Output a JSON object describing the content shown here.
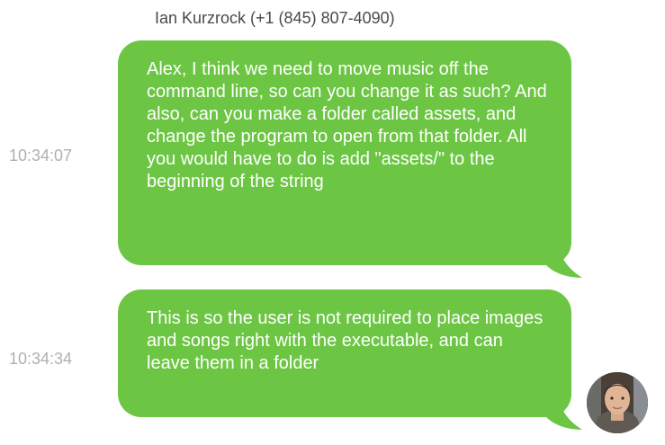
{
  "conversation": {
    "sender": "Ian Kurzrock (+1 (845) 807-4090)",
    "messages": [
      {
        "time": "10:34:07",
        "text": "Alex, I think we need to move music off the command line, so can you change it as such? And also, can you make a folder called assets, and change the program to open from that folder. All you would have to do is add \"assets/\" to the beginning of the string"
      },
      {
        "time": "10:34:34",
        "text": "This is so the user is not required to place images and songs right with the executable, and can leave them in a folder"
      }
    ]
  },
  "colors": {
    "bubble": "#6cc644",
    "bubble_text": "#ffffff",
    "timestamp": "#b0b0b0",
    "sender": "#4a4a4a"
  },
  "icons": {
    "avatar": "user-avatar-photo"
  }
}
